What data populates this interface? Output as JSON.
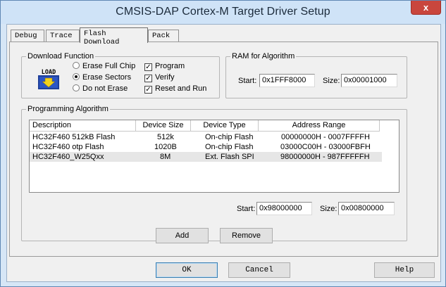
{
  "window": {
    "title": "CMSIS-DAP Cortex-M Target Driver Setup",
    "close_glyph": "x"
  },
  "tabs": [
    {
      "label": "Debug"
    },
    {
      "label": "Trace"
    },
    {
      "label": "Flash Download"
    },
    {
      "label": "Pack"
    }
  ],
  "download_function": {
    "title": "Download Function",
    "icon_text": "LOAD",
    "erase_full_chip": "Erase Full Chip",
    "erase_sectors": "Erase Sectors",
    "do_not_erase": "Do not Erase",
    "selected_erase": "Erase Sectors",
    "program": {
      "label": "Program",
      "checked": true
    },
    "verify": {
      "label": "Verify",
      "checked": true
    },
    "reset_and_run": {
      "label": "Reset and Run",
      "checked": true
    }
  },
  "ram_for_algorithm": {
    "title": "RAM for Algorithm",
    "start_label": "Start:",
    "start_value": "0x1FFF8000",
    "size_label": "Size:",
    "size_value": "0x00001000"
  },
  "programming_algorithm": {
    "title": "Programming Algorithm",
    "columns": [
      "Description",
      "Device Size",
      "Device Type",
      "Address Range"
    ],
    "rows": [
      [
        "HC32F460 512kB Flash",
        "512k",
        "On-chip Flash",
        "00000000H - 0007FFFFH"
      ],
      [
        "HC32F460 otp Flash",
        "1020B",
        "On-chip Flash",
        "03000C00H - 03000FBFH"
      ],
      [
        "HC32F460_W25Qxx",
        "8M",
        "Ext. Flash SPI",
        "98000000H - 987FFFFFH"
      ]
    ],
    "selected_row": 2,
    "start_label": "Start:",
    "start_value": "0x98000000",
    "size_label": "Size:",
    "size_value": "0x00800000"
  },
  "actions": {
    "add": "Add",
    "remove": "Remove"
  },
  "footer": {
    "ok": "OK",
    "cancel": "Cancel",
    "help": "Help"
  }
}
